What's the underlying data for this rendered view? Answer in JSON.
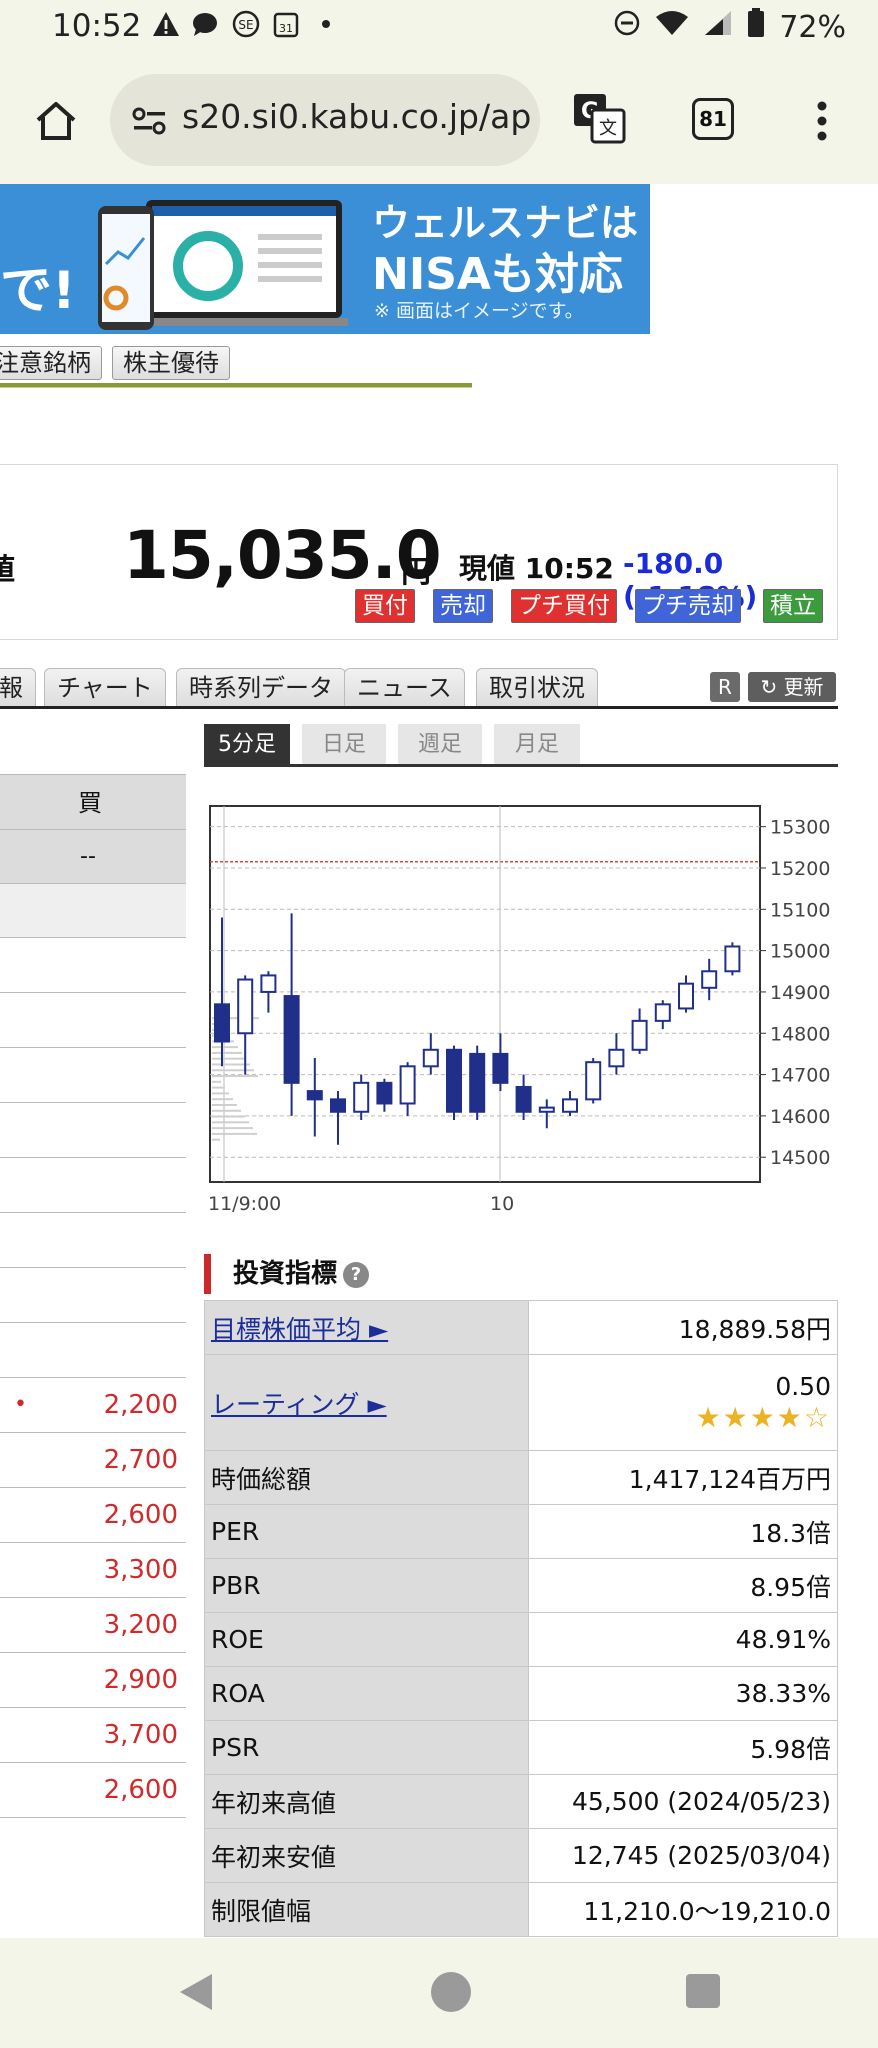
{
  "status_bar": {
    "time": "10:52",
    "battery": "72%"
  },
  "browser": {
    "url": "s20.si0.kabu.co.jp/ap",
    "tab_count": "81"
  },
  "banner": {
    "left_text": "で!",
    "line1": "ウェルスナビは",
    "line2": "NISAも対応",
    "note": "※ 画面はイメージです。"
  },
  "tags": [
    "注意銘柄",
    "株主優待"
  ],
  "quote": {
    "label": "値",
    "price": "15,035.0",
    "unit": "円",
    "current_label": "現値 10:52",
    "change": "-180.0 (-1.18%)",
    "buttons": [
      "買付",
      "売却",
      "プチ買付",
      "プチ売却",
      "積立"
    ]
  },
  "tabs": [
    "報",
    "チャート",
    "時系列データ",
    "ニュース",
    "取引状況"
  ],
  "refresh": {
    "r_label": "R",
    "update_label": "更新"
  },
  "period_tabs": [
    "5分足",
    "日足",
    "週足",
    "月足"
  ],
  "order_book": {
    "header": "買",
    "row2": "--",
    "bids": [
      "2,200",
      "2,700",
      "2,600",
      "3,300",
      "3,200",
      "2,900",
      "3,700",
      "2,600"
    ]
  },
  "chart_data": {
    "type": "candlestick",
    "y_ticks": [
      15300,
      15200,
      15100,
      15000,
      14900,
      14800,
      14700,
      14600,
      14500
    ],
    "ylim": [
      14440,
      15350
    ],
    "x_tick_labels": [
      "11/9:00",
      "10"
    ],
    "reference_line": 15215,
    "candles": [
      {
        "o": 14870,
        "h": 15080,
        "l": 14720,
        "c": 14780
      },
      {
        "o": 14800,
        "h": 14940,
        "l": 14700,
        "c": 14930
      },
      {
        "o": 14900,
        "h": 14950,
        "l": 14850,
        "c": 14940
      },
      {
        "o": 14890,
        "h": 15090,
        "l": 14600,
        "c": 14680
      },
      {
        "o": 14660,
        "h": 14740,
        "l": 14550,
        "c": 14640
      },
      {
        "o": 14640,
        "h": 14660,
        "l": 14530,
        "c": 14610
      },
      {
        "o": 14610,
        "h": 14700,
        "l": 14590,
        "c": 14680
      },
      {
        "o": 14680,
        "h": 14690,
        "l": 14610,
        "c": 14630
      },
      {
        "o": 14630,
        "h": 14730,
        "l": 14600,
        "c": 14720
      },
      {
        "o": 14720,
        "h": 14800,
        "l": 14700,
        "c": 14760
      },
      {
        "o": 14760,
        "h": 14770,
        "l": 14590,
        "c": 14610
      },
      {
        "o": 14750,
        "h": 14770,
        "l": 14590,
        "c": 14610
      },
      {
        "o": 14750,
        "h": 14800,
        "l": 14660,
        "c": 14680
      },
      {
        "o": 14670,
        "h": 14700,
        "l": 14590,
        "c": 14610
      },
      {
        "o": 14610,
        "h": 14640,
        "l": 14570,
        "c": 14620
      },
      {
        "o": 14610,
        "h": 14660,
        "l": 14600,
        "c": 14640
      },
      {
        "o": 14640,
        "h": 14740,
        "l": 14630,
        "c": 14730
      },
      {
        "o": 14720,
        "h": 14800,
        "l": 14700,
        "c": 14760
      },
      {
        "o": 14760,
        "h": 14860,
        "l": 14750,
        "c": 14830
      },
      {
        "o": 14830,
        "h": 14880,
        "l": 14810,
        "c": 14870
      },
      {
        "o": 14860,
        "h": 14940,
        "l": 14850,
        "c": 14920
      },
      {
        "o": 14910,
        "h": 14980,
        "l": 14880,
        "c": 14950
      },
      {
        "o": 14950,
        "h": 15020,
        "l": 14940,
        "c": 15010
      }
    ]
  },
  "indicators": {
    "title": "投資指標",
    "help": "?",
    "rows": [
      {
        "label": "目標株価平均 ►",
        "value": "18,889.58円",
        "link": true
      },
      {
        "label": "レーティング ►",
        "value": "0.50",
        "link": true,
        "stars": "★★★★",
        "empty_star": "☆"
      },
      {
        "label": "時価総額",
        "value": "1,417,124百万円"
      },
      {
        "label": "PER",
        "value": "18.3倍"
      },
      {
        "label": "PBR",
        "value": "8.95倍"
      },
      {
        "label": "ROE",
        "value": "48.91%"
      },
      {
        "label": "ROA",
        "value": "38.33%"
      },
      {
        "label": "PSR",
        "value": "5.98倍"
      },
      {
        "label": "年初来高値",
        "value": "45,500 (2024/05/23)"
      },
      {
        "label": "年初来安値",
        "value": "12,745 (2025/03/04)"
      },
      {
        "label": "制限値幅",
        "value": "11,210.0〜19,210.0"
      }
    ]
  }
}
